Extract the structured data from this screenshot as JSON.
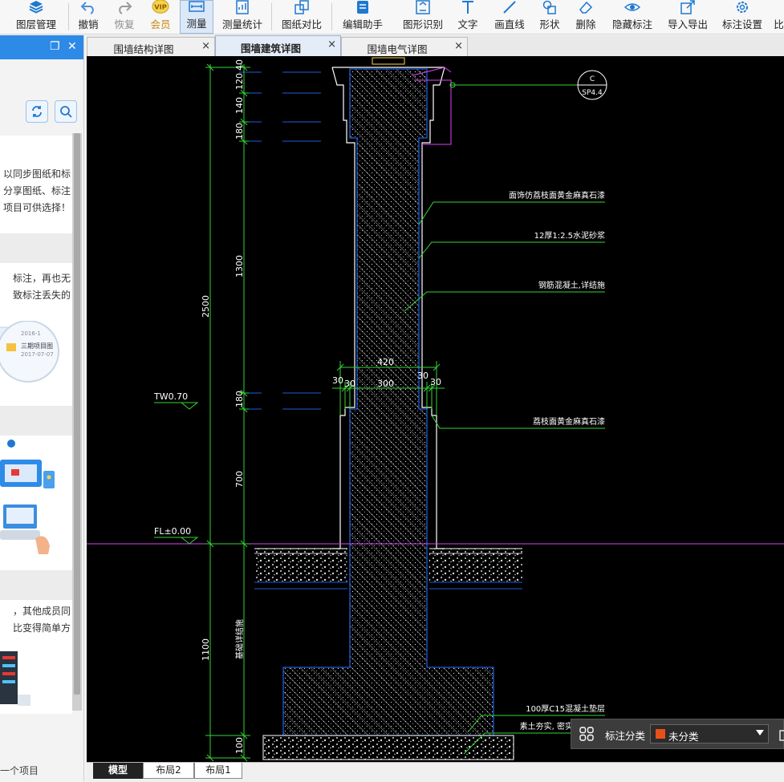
{
  "toolbar": {
    "items": [
      {
        "label": "图层管理",
        "icon": "layers-icon"
      },
      {
        "label": "撤销",
        "icon": "undo-icon"
      },
      {
        "label": "恢复",
        "icon": "redo-icon"
      },
      {
        "label": "会员",
        "icon": "vip-icon",
        "badge": "VIP"
      },
      {
        "label": "测量",
        "icon": "measure-icon"
      },
      {
        "label": "测量统计",
        "icon": "measure-stats-icon"
      },
      {
        "label": "图纸对比",
        "icon": "compare-icon"
      },
      {
        "label": "编辑助手",
        "icon": "edit-assistant-icon"
      },
      {
        "label": "图形识别",
        "icon": "shape-recognition-icon"
      },
      {
        "label": "文字",
        "icon": "text-icon"
      },
      {
        "label": "画直线",
        "icon": "line-icon"
      },
      {
        "label": "形状",
        "icon": "shape-icon"
      },
      {
        "label": "删除",
        "icon": "eraser-icon"
      },
      {
        "label": "隐藏标注",
        "icon": "eye-icon"
      },
      {
        "label": "导入导出",
        "icon": "import-export-icon"
      },
      {
        "label": "标注设置",
        "icon": "settings-icon"
      },
      {
        "label": "比",
        "icon": "compare-ratio-icon"
      }
    ]
  },
  "left_panel": {
    "card1": [
      "以同步图纸和标",
      "分享图纸、标注",
      "项目可供选择！"
    ],
    "card2": [
      "标注，再也无",
      "致标注丢失的"
    ],
    "thumbnail": {
      "date1": "2016-1",
      "title": "三期项目图",
      "date2": "2017-07-07"
    },
    "card4": [
      "，其他成员同",
      "比变得简单方"
    ],
    "footer": "一个项目"
  },
  "tabs": [
    {
      "label": "围墙结构详图",
      "close": "×"
    },
    {
      "label": "围墙建筑详图",
      "close": "×"
    },
    {
      "label": "围墙电气详图",
      "close": "×"
    }
  ],
  "drawing": {
    "dims_left": [
      "120",
      "40",
      "140",
      "180",
      "1300",
      "2500",
      "180",
      "700",
      "1100",
      "100"
    ],
    "dims_top": [
      "420",
      "30",
      "30",
      "300",
      "30",
      "30"
    ],
    "levels": [
      "TW0.70",
      "FL±0.00"
    ],
    "notes": [
      "面饰仿荔枝面黄金麻真石漆",
      "12厚1:2.5水泥砂浆",
      "钢筋混凝土,详结施",
      "荔枝面黄金麻真石漆",
      "100厚C15混凝土垫层",
      "素土夯实, 密实"
    ],
    "vertical_note": "基础详结施",
    "callout": {
      "top": "C",
      "bottom": "SP4.4"
    }
  },
  "annotation": {
    "label": "标注分类",
    "value": "未分类",
    "color": "#e8501a"
  },
  "layout_tabs": [
    "模型",
    "布局2",
    "布局1"
  ]
}
